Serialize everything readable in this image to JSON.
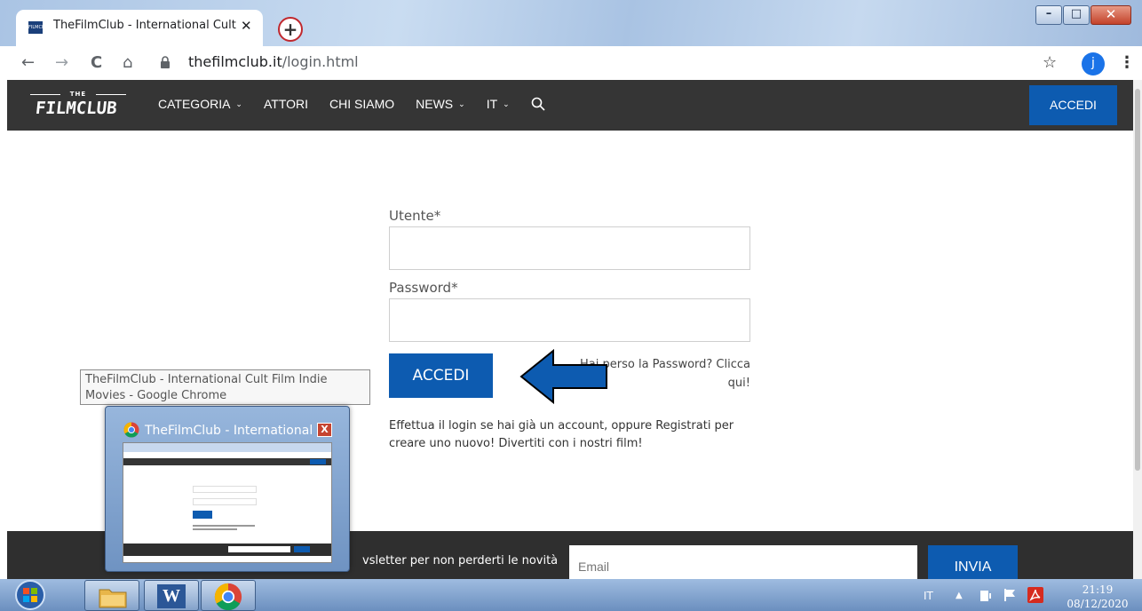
{
  "browser": {
    "tab_title": "TheFilmClub - International Cult Film Indie Movies",
    "favicon_text": "FILMCLUB",
    "close_glyph": "✕",
    "new_tab_glyph": "+",
    "url_host": "thefilmclub.it",
    "url_path": "/login.html",
    "profile_initial": "j",
    "back_glyph": "←",
    "forward_glyph": "→",
    "reload_glyph": "C",
    "home_glyph": "⌂",
    "star_glyph": "☆",
    "menu_glyph": "⋮",
    "minimize_glyph": "–",
    "maximize_glyph": "□",
    "window_close_glyph": "✕"
  },
  "header": {
    "logo_the": "THE",
    "logo_main": "FILMCLUB",
    "nav": [
      {
        "label": "CATEGORIA",
        "has_dropdown": true
      },
      {
        "label": "ATTORI",
        "has_dropdown": false
      },
      {
        "label": "CHI SIAMO",
        "has_dropdown": false
      },
      {
        "label": "NEWS",
        "has_dropdown": true
      },
      {
        "label": "IT",
        "has_dropdown": true
      }
    ],
    "chevron_glyph": "⌄",
    "login_button": "ACCEDI"
  },
  "login_form": {
    "username_label": "Utente*",
    "username_value": "",
    "password_label": "Password*",
    "password_value": "",
    "submit_label": "ACCEDI",
    "forgot_line1": "Hai perso la Password? Clicca",
    "forgot_line2": "qui!",
    "info_text": "Effettua il login se hai già un account, oppure Registrati per creare uno nuovo! Divertiti con i nostri film!"
  },
  "annotation": {
    "arrow_color": "#0d5bb0"
  },
  "footer": {
    "newsletter_text": "vsletter per non perderti le novità",
    "email_placeholder": "Email",
    "submit_label": "INVIA"
  },
  "taskbar_preview": {
    "tooltip_text": "TheFilmClub - International Cult Film Indie Movies - Google Chrome",
    "thumb_title": "TheFilmClub - International ...",
    "close_glyph": "X"
  },
  "taskbar": {
    "word_letter": "W",
    "language": "IT",
    "tray_arrow": "▲",
    "time": "21:19",
    "date": "08/12/2020"
  },
  "colors": {
    "accent": "#0d5bb0",
    "header_bg": "#353535",
    "footer_bg": "#2f2f2f"
  }
}
